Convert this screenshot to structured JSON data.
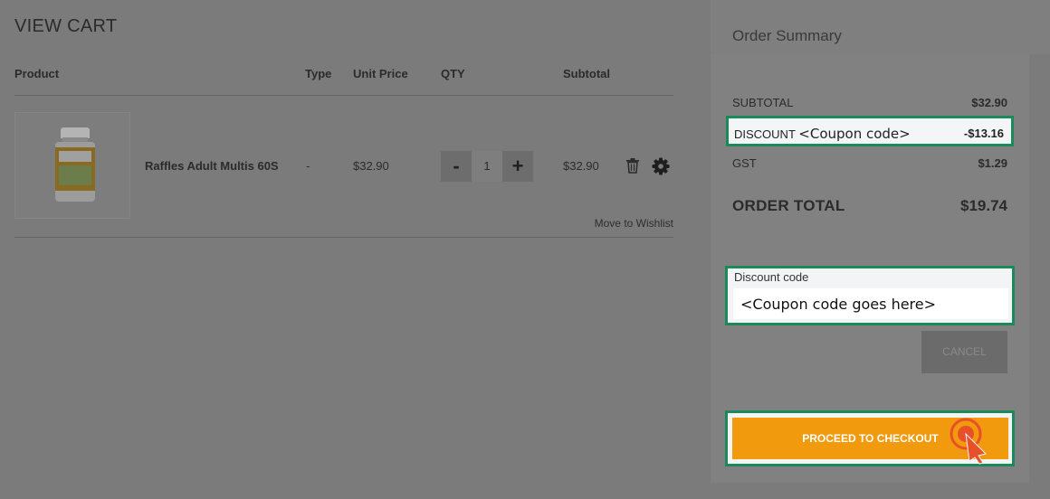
{
  "cart": {
    "title": "VIEW CART",
    "columns": {
      "product": "Product",
      "type": "Type",
      "unit_price": "Unit Price",
      "qty": "QTY",
      "subtotal": "Subtotal"
    },
    "items": [
      {
        "name": "Raffles Adult Multis 60S",
        "type": "-",
        "unit_price": "$32.90",
        "qty": "1",
        "subtotal": "$32.90",
        "decrement": "-",
        "increment": "+",
        "move_to_wishlist": "Move to Wishlist"
      }
    ]
  },
  "summary": {
    "title": "Order Summary",
    "subtotal_label": "SUBTOTAL",
    "subtotal_value": "$32.90",
    "discount_label": "DISCOUNT",
    "discount_code": "<Coupon code>",
    "discount_value": "-$13.16",
    "gst_label": "GST",
    "gst_value": "$1.29",
    "total_label": "ORDER TOTAL",
    "total_value": "$19.74",
    "discount_code_label": "Discount code",
    "discount_code_value": "<Coupon code goes here>",
    "cancel_label": "CANCEL",
    "checkout_label": "PROCEED TO CHECKOUT"
  },
  "colors": {
    "highlight": "#1a8a5a",
    "checkout": "#f29a0e",
    "overlay": "#7b7b7b"
  }
}
